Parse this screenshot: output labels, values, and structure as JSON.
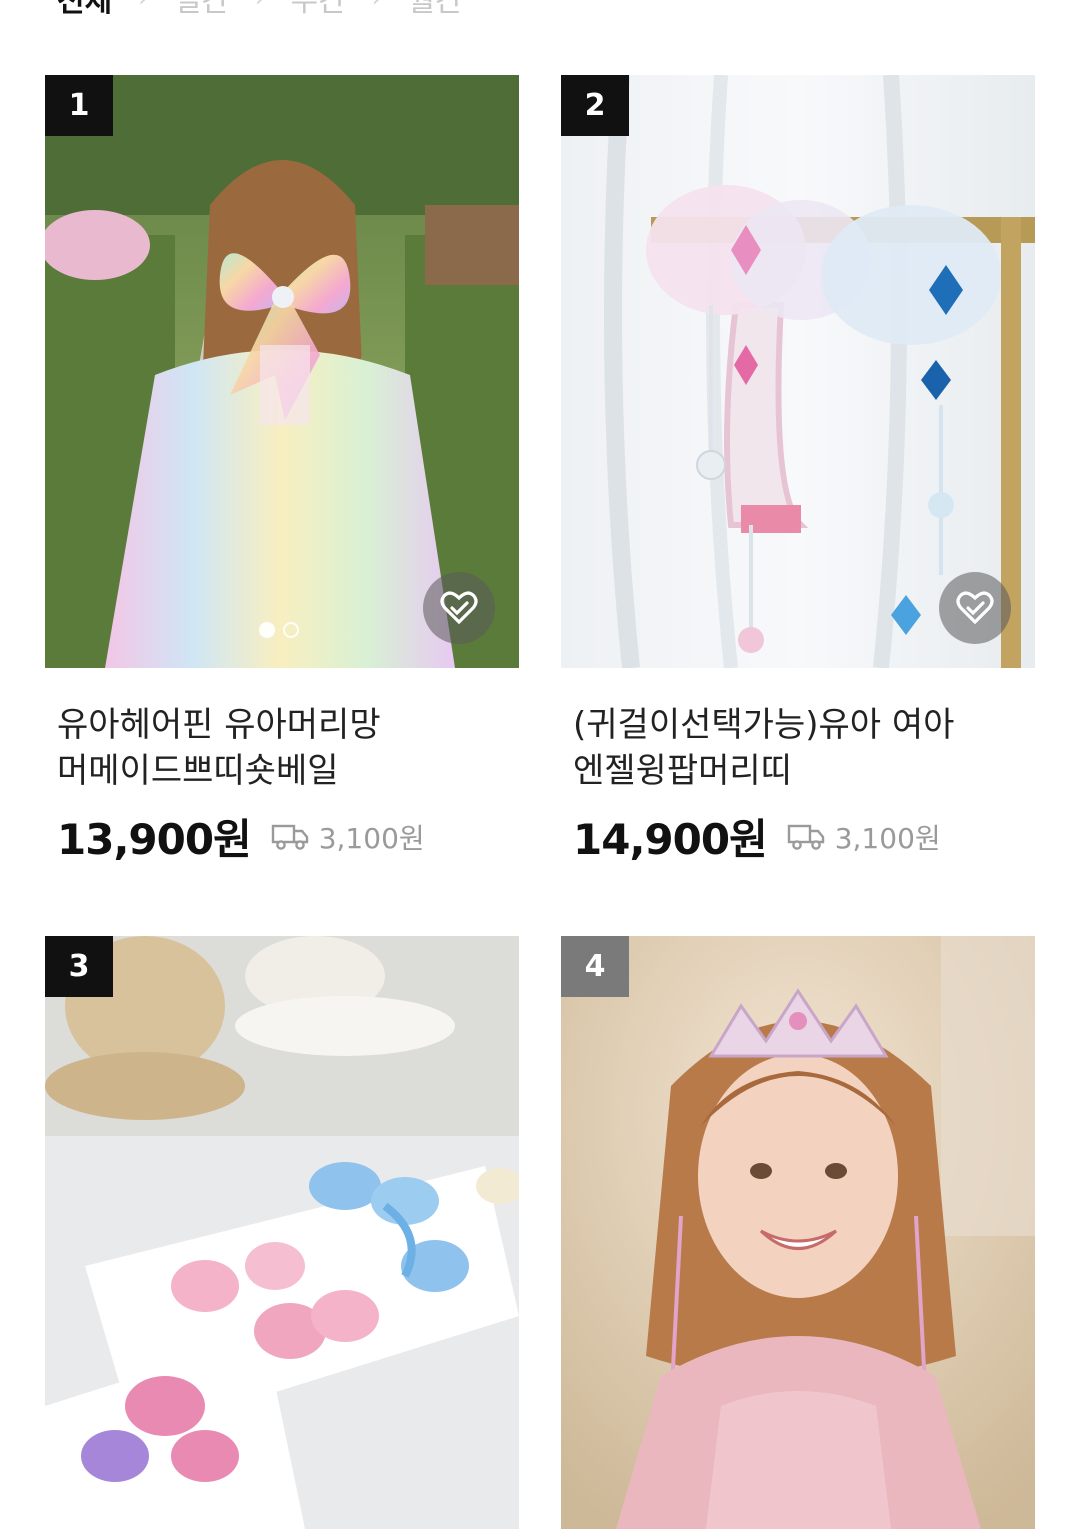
{
  "tabs": [
    {
      "label": "전체"
    },
    {
      "label": "일간"
    },
    {
      "label": "주간"
    },
    {
      "label": "월간"
    }
  ],
  "products": [
    {
      "rank": "1",
      "title_line1": "유아헤어핀 유아머리망",
      "title_line2": "머메이드쁘띠숏베일",
      "price": "13,900원",
      "shipping": "3,100원",
      "rank_color": "#111111"
    },
    {
      "rank": "2",
      "title_line1": "(귀걸이선택가능)유아 여아",
      "title_line2": "엔젤윙팝머리띠",
      "price": "14,900원",
      "shipping": "3,100원",
      "rank_color": "#111111"
    },
    {
      "rank": "3",
      "rank_color": "#111111"
    },
    {
      "rank": "4",
      "rank_color": "#7a7a7a"
    }
  ],
  "icons": {
    "wishlist": "heart-check-icon",
    "shipping": "truck-icon"
  }
}
